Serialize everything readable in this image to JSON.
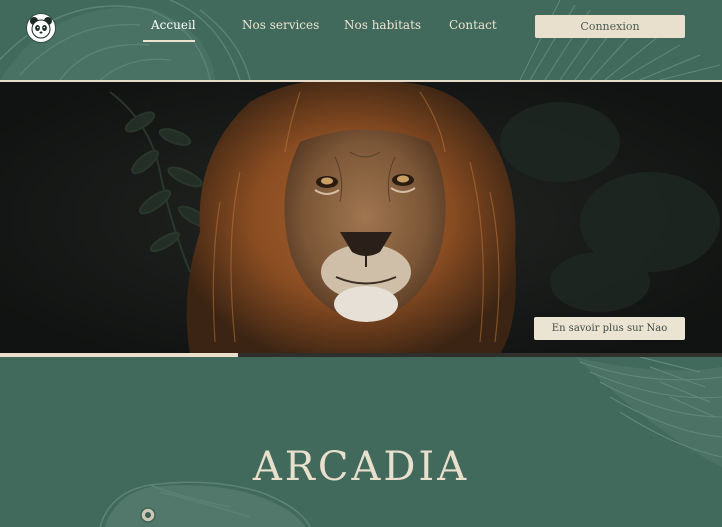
{
  "header": {
    "logo_icon": "panda-icon",
    "nav": [
      {
        "label": "Accueil",
        "active": true
      },
      {
        "label": "Nos services",
        "active": false
      },
      {
        "label": "Nos habitats",
        "active": false
      },
      {
        "label": "Contact",
        "active": false
      }
    ],
    "login_label": "Connexion"
  },
  "hero": {
    "image": "lion-photo",
    "cta_label": "En savoir plus sur Nao",
    "slider_progress": 0.33
  },
  "section": {
    "title": "ARCADIA"
  },
  "colors": {
    "background_green": "#416a5d",
    "cream": "#e8dfcc",
    "hero_dark": "#151816"
  }
}
